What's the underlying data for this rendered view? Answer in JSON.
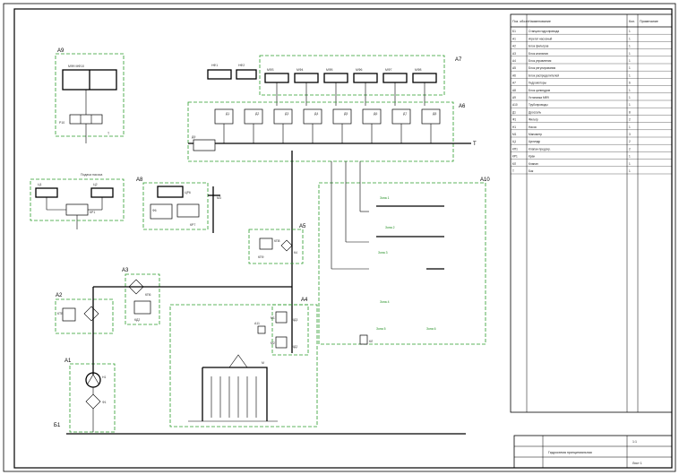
{
  "frame": {
    "line_color": "#000000",
    "group_color": "#2b9c2b"
  },
  "blocks": {
    "a1": "А1",
    "a2": "А2",
    "a3": "А3",
    "a4": "А4",
    "a5": "А5",
    "a6": "А6",
    "a7": "А7",
    "a8": "А8",
    "a9": "А9",
    "a10": "А10",
    "b1": "Б1"
  },
  "components": {
    "m9_m10": "МФ9   МФ10",
    "p10": "Р10",
    "u1": "Ц1",
    "u2": "Ц2",
    "kp1": "КР1",
    "cr6": "ЦР6",
    "f6": "Ф6",
    "kr7": "КР7",
    "m3": "М3",
    "kp6": "КП6",
    "kd2": "КД2",
    "k4": "К4",
    "kp8": "КП8",
    "kp9": "КП9",
    "kl": "КЛ",
    "ktb": "КТВ",
    "n1": "Н1",
    "f1": "Ф1",
    "m1": "М1",
    "kd3": "КД3",
    "m2": "М2",
    "kd2b": "КД2",
    "at1": "А11",
    "m_top": "М",
    "t_main": "Т",
    "t_side": "Т",
    "nf1": "НФ1",
    "nf2": "НФ2",
    "mot": [
      "МФ3",
      "МФ4",
      "МФ5",
      "МФ6",
      "МФ7",
      "МФ8"
    ],
    "d": [
      "Д1",
      "Д2",
      "Д3",
      "Д4",
      "Д5",
      "Д6",
      "Д7",
      "Д8"
    ],
    "d9": "Д9"
  },
  "table": {
    "col_headers": [
      "Поз. обозн.",
      "Наименование",
      "Кол.",
      "Примечание"
    ],
    "rows_count_note": "",
    "rows": [
      [
        "Б1",
        "Станция гидропривода",
        "1",
        ""
      ],
      [
        "А1",
        "Агрегат насосный",
        "1",
        ""
      ],
      [
        "А2",
        "Блок фильтров",
        "1",
        ""
      ],
      [
        "А3",
        "Блок клапанов",
        "1",
        ""
      ],
      [
        "А4",
        "Блок управления",
        "1",
        ""
      ],
      [
        "А5",
        "Блок регулирования",
        "1",
        ""
      ],
      [
        "А6",
        "Блок распределителей",
        "1",
        ""
      ],
      [
        "А7",
        "Гидромоторы",
        "6",
        ""
      ],
      [
        "А8",
        "Блок цилиндров",
        "1",
        ""
      ],
      [
        "А9",
        "Установка МФ9",
        "1",
        ""
      ],
      [
        "А10",
        "Трубопроводы",
        "1",
        ""
      ],
      [
        "Д1",
        "Дроссель",
        "8",
        ""
      ],
      [
        "Ф1",
        "Фильтр",
        "2",
        ""
      ],
      [
        "Н1",
        "Насос",
        "1",
        ""
      ],
      [
        "М1",
        "Манометр",
        "3",
        ""
      ],
      [
        "Ц1",
        "Цилиндр",
        "2",
        ""
      ],
      [
        "КП1",
        "Клапан предохр.",
        "2",
        ""
      ],
      [
        "КР1",
        "Кран",
        "1",
        ""
      ],
      [
        "КЛ",
        "Клапан",
        "1",
        ""
      ],
      [
        "Т",
        "Бак",
        "1",
        ""
      ]
    ]
  },
  "title_block": {
    "name": "Гидросхема принципиальная",
    "sheet": "Лист 1",
    "scale": "1:1",
    "mass": ""
  },
  "annotations": {
    "pump_group": "Подача насоса",
    "zone_1": "Зона 1",
    "zone_2": "Зона 2",
    "zone_3": "Зона 3",
    "zone_4": "Зона 4",
    "zone_5": "Зона 5",
    "zone_6": "Зона 6"
  }
}
